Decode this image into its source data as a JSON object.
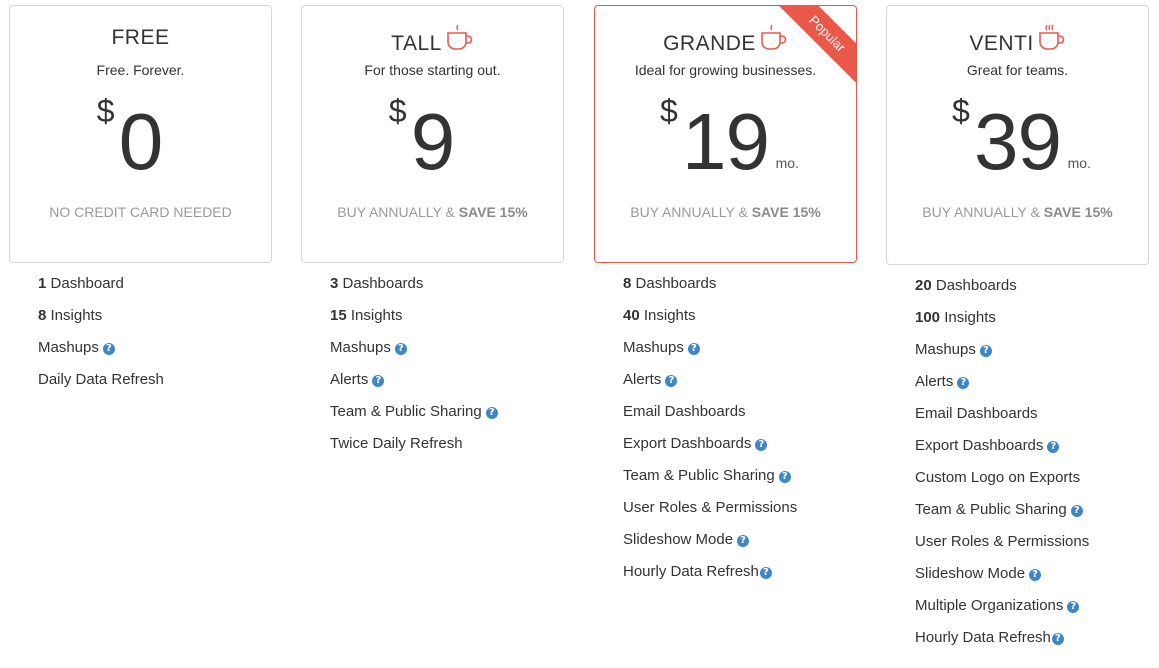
{
  "plans": [
    {
      "name": "FREE",
      "tagline": "Free. Forever.",
      "currency": "$",
      "amount": "0",
      "period": "",
      "note": "NO CREDIT CARD NEEDED",
      "note_bold": "",
      "badge": "",
      "cup_icon": "",
      "features": [
        {
          "count": "1",
          "label": "Dashboard",
          "help": false
        },
        {
          "count": "8",
          "label": "Insights",
          "help": false
        },
        {
          "count": "",
          "label": "Mashups",
          "help": true
        },
        {
          "count": "",
          "label": "Daily Data Refresh",
          "help": false
        }
      ]
    },
    {
      "name": "TALL",
      "tagline": "For those starting out.",
      "currency": "$",
      "amount": "9",
      "period": "",
      "note": "BUY ANNUALLY & ",
      "note_bold": "SAVE 15%",
      "badge": "",
      "cup_icon": "coffee-cup-icon",
      "features": [
        {
          "count": "3",
          "label": "Dashboards",
          "help": false
        },
        {
          "count": "15",
          "label": "Insights",
          "help": false
        },
        {
          "count": "",
          "label": "Mashups",
          "help": true
        },
        {
          "count": "",
          "label": "Alerts",
          "help": true
        },
        {
          "count": "",
          "label": "Team & Public Sharing",
          "help": true
        },
        {
          "count": "",
          "label": "Twice Daily Refresh",
          "help": false
        }
      ]
    },
    {
      "name": "GRANDE",
      "tagline": "Ideal for growing businesses.",
      "currency": "$",
      "amount": "19",
      "period": "mo.",
      "note": "BUY ANNUALLY & ",
      "note_bold": "SAVE 15%",
      "badge": "Popular",
      "cup_icon": "coffee-cup-icon",
      "features": [
        {
          "count": "8",
          "label": "Dashboards",
          "help": false
        },
        {
          "count": "40",
          "label": "Insights",
          "help": false
        },
        {
          "count": "",
          "label": "Mashups",
          "help": true
        },
        {
          "count": "",
          "label": "Alerts",
          "help": true
        },
        {
          "count": "",
          "label": "Email Dashboards",
          "help": false
        },
        {
          "count": "",
          "label": "Export Dashboards",
          "help": true
        },
        {
          "count": "",
          "label": "Team & Public Sharing",
          "help": true
        },
        {
          "count": "",
          "label": "User Roles & Permissions",
          "help": false
        },
        {
          "count": "",
          "label": "Slideshow Mode",
          "help": true
        },
        {
          "count": "",
          "label": "Hourly Data Refresh",
          "help": true
        }
      ]
    },
    {
      "name": "VENTI",
      "tagline": "Great for teams.",
      "currency": "$",
      "amount": "39",
      "period": "mo.",
      "note": "BUY ANNUALLY & ",
      "note_bold": "SAVE 15%",
      "badge": "",
      "cup_icon": "steaming-cup-icon",
      "features": [
        {
          "count": "20",
          "label": "Dashboards",
          "help": false
        },
        {
          "count": "100",
          "label": "Insights",
          "help": false
        },
        {
          "count": "",
          "label": "Mashups",
          "help": true
        },
        {
          "count": "",
          "label": "Alerts",
          "help": true
        },
        {
          "count": "",
          "label": "Email Dashboards",
          "help": false
        },
        {
          "count": "",
          "label": "Export Dashboards",
          "help": true
        },
        {
          "count": "",
          "label": "Custom Logo on Exports",
          "help": false
        },
        {
          "count": "",
          "label": "Team & Public Sharing",
          "help": true
        },
        {
          "count": "",
          "label": "User Roles & Permissions",
          "help": false
        },
        {
          "count": "",
          "label": "Slideshow Mode",
          "help": true
        },
        {
          "count": "",
          "label": "Multiple Organizations",
          "help": true
        },
        {
          "count": "",
          "label": "Hourly Data Refresh",
          "help": true
        }
      ]
    }
  ],
  "help_glyph": "?",
  "colors": {
    "accent": "#e8594a",
    "help": "#3d87c9",
    "text": "#333333",
    "muted": "#9a9a9a"
  }
}
